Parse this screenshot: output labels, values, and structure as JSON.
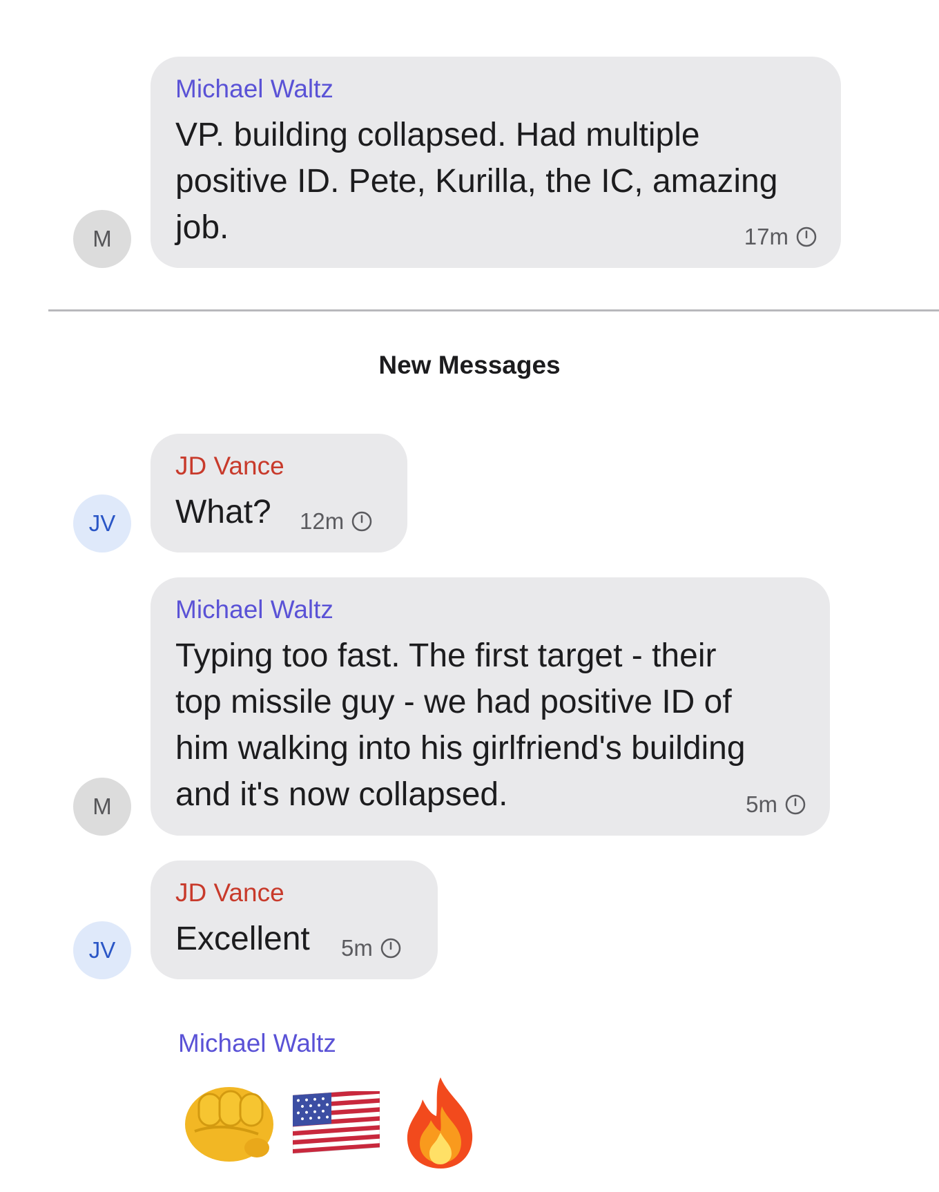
{
  "messages": [
    {
      "avatar": "M",
      "sender": "Michael Waltz",
      "lines": [
        "VP.  building collapsed. Had multiple",
        "positive ID. Pete, Kurilla, the IC, amazing",
        "job."
      ],
      "time": "17m"
    },
    {
      "avatar": "JV",
      "sender": "JD Vance",
      "lines": [
        "What?"
      ],
      "time": "12m"
    },
    {
      "avatar": "M",
      "sender": "Michael Waltz",
      "lines": [
        "Typing too fast. The first target - their",
        "top missile guy - we had positive ID of",
        "him walking into his girlfriend's building",
        "and it's now collapsed."
      ],
      "time": "5m"
    },
    {
      "avatar": "JV",
      "sender": "JD Vance",
      "lines": [
        "Excellent"
      ],
      "time": "5m"
    }
  ],
  "new_messages_label": "New Messages",
  "last_message": {
    "sender": "Michael Waltz",
    "emojis": [
      "oncoming-fist",
      "us-flag",
      "fire"
    ]
  },
  "colors": {
    "waltz_name": "#5a52d6",
    "vance_name": "#c83a2b",
    "bubble": "#e9e9eb"
  }
}
